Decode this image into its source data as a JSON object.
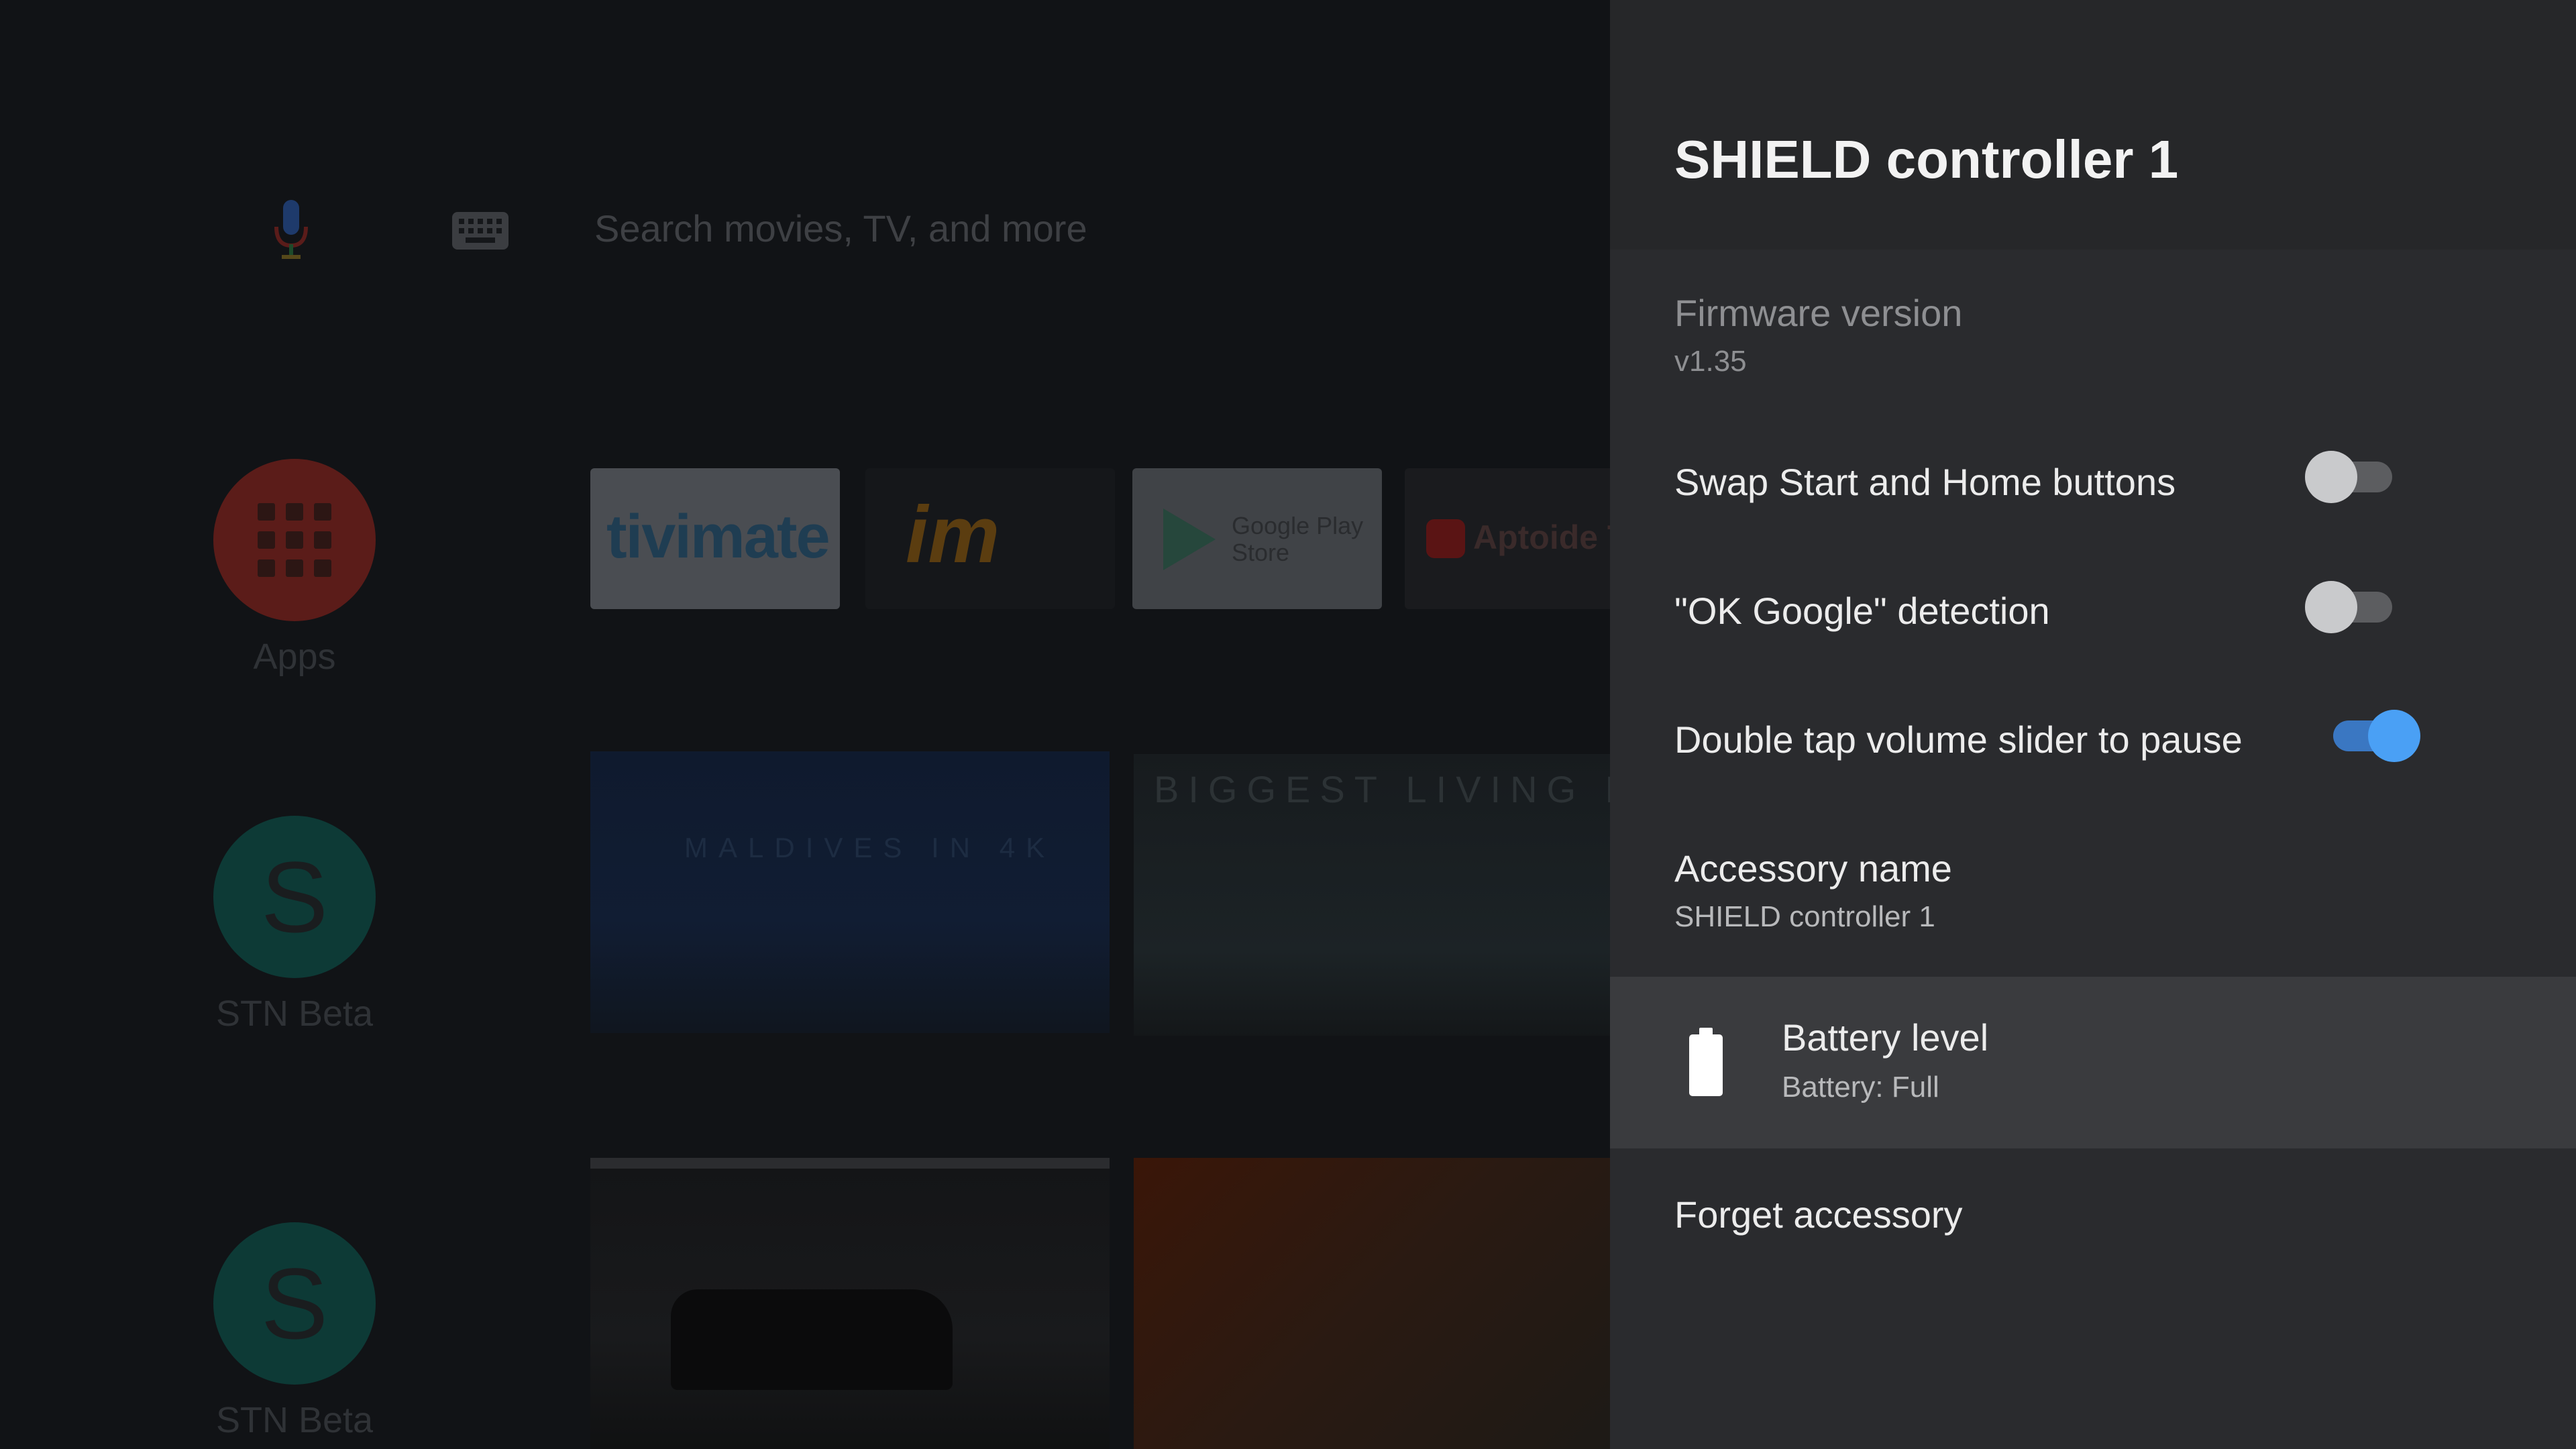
{
  "launcher": {
    "search_placeholder": "Search movies, TV, and more",
    "side_items": [
      {
        "label": "Apps",
        "icon": "apps-grid-icon",
        "color": "#5b1c19"
      },
      {
        "label": "STN Beta",
        "letter": "S",
        "color": "#0d3a36"
      },
      {
        "label": "STN Beta",
        "letter": "S",
        "color": "#0d3a36"
      }
    ],
    "app_tiles": [
      {
        "name": "tivimate",
        "text": "tivimate"
      },
      {
        "name": "imp",
        "text": "im"
      },
      {
        "name": "google-play-store",
        "text": "Google Play Store"
      },
      {
        "name": "aptoide-tv",
        "text": "Aptoide T"
      }
    ],
    "content_tiles": [
      {
        "name": "maldives-4k",
        "text": "MALDIVES IN 4K"
      },
      {
        "name": "biggest-fish",
        "text": "BIGGEST LIVING FIS"
      },
      {
        "name": "night-car"
      },
      {
        "name": "movie-poster"
      }
    ]
  },
  "panel": {
    "title": "SHIELD controller 1",
    "firmware": {
      "label": "Firmware version",
      "value": "v1.35"
    },
    "toggles": [
      {
        "label": "Swap Start and Home buttons",
        "on": false
      },
      {
        "label": "\"OK Google\" detection",
        "on": false
      },
      {
        "label": "Double tap volume slider to pause",
        "on": true
      }
    ],
    "accessory": {
      "label": "Accessory name",
      "value": "SHIELD controller 1"
    },
    "battery": {
      "label": "Battery level",
      "value": "Battery: Full",
      "icon": "battery-full-icon"
    },
    "forget_label": "Forget accessory"
  },
  "colors": {
    "panel_bg": "#2a2b2e",
    "selected_row_bg": "#3a3b3e",
    "toggle_on": "#4aa0f5",
    "toggle_off": "#c9cacc"
  }
}
